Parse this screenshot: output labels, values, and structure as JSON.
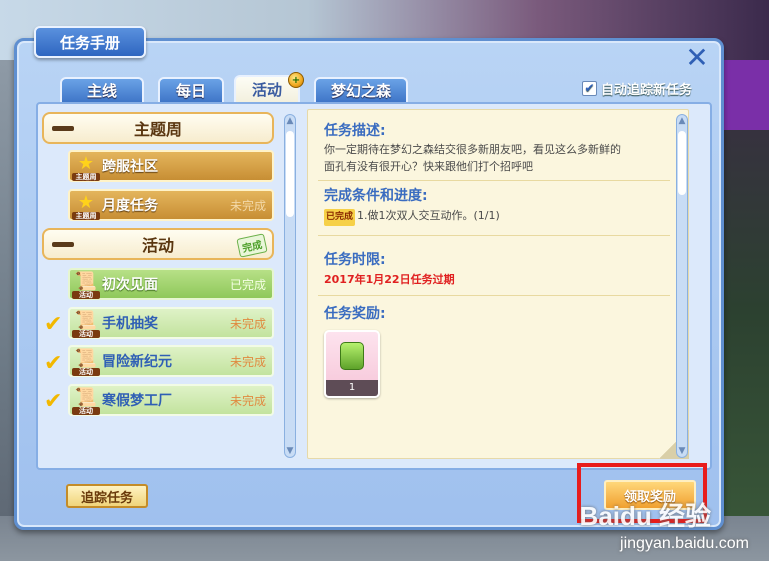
{
  "panel": {
    "title": "任务手册",
    "auto_track_label": "自动追踪新任务",
    "auto_track_checked": true
  },
  "tabs": [
    {
      "label": "主线",
      "active": false
    },
    {
      "label": "每日",
      "active": false
    },
    {
      "label": "活动",
      "active": true
    },
    {
      "label": "梦幻之森",
      "active": false
    }
  ],
  "task_list": {
    "categories": [
      {
        "label": "主题周",
        "badge": ""
      },
      {
        "label": "活动",
        "badge": "完成"
      }
    ],
    "items": [
      {
        "icon_label": "主题周",
        "name": "跨服社区",
        "status": ""
      },
      {
        "icon_label": "主题周",
        "name": "月度任务",
        "status": "未完成"
      },
      {
        "icon_label": "活动",
        "name": "初次见面",
        "status": "已完成"
      },
      {
        "icon_label": "活动",
        "name": "手机抽奖",
        "status": "未完成"
      },
      {
        "icon_label": "活动",
        "name": "冒险新纪元",
        "status": "未完成"
      },
      {
        "icon_label": "活动",
        "name": "寒假梦工厂",
        "status": "未完成"
      }
    ]
  },
  "detail": {
    "desc_title": "任务描述:",
    "desc_text_1": "你一定期待在梦幻之森结交很多新朋友吧，看见这么多新鲜的",
    "desc_text_2": "面孔有没有很开心？快来跟他们打个招呼吧",
    "cond_title": "完成条件和进度:",
    "cond_tag": "已完成",
    "cond_text": "1.做1次双人交互动作。(1/1)",
    "limit_title": "任务时限:",
    "limit_text": "2017年1月22日任务过期",
    "reward_title": "任务奖励:",
    "reward_count": "1"
  },
  "buttons": {
    "track": "追踪任务",
    "claim": "领取奖励"
  },
  "watermark": {
    "logo": "Baidu 经验",
    "url": "jingyan.baidu.com"
  },
  "colors": {
    "panel_blue": "#9fc0ee",
    "highlight_red": "#e81c1c",
    "deadline_red": "#e02020"
  }
}
